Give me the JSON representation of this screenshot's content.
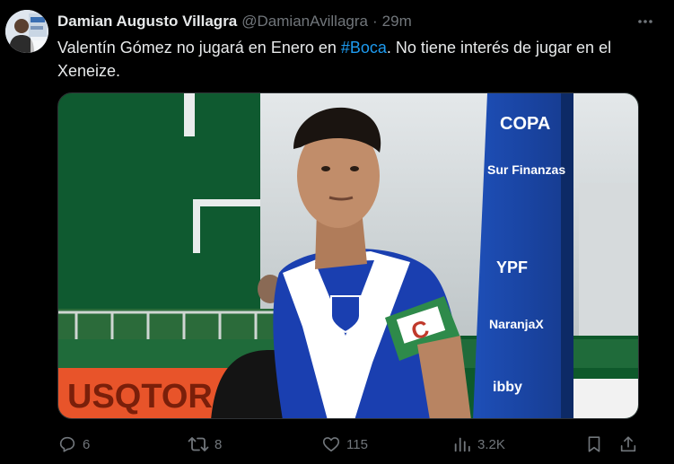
{
  "tweet": {
    "display_name": "Damian Augusto Villagra",
    "handle": "@DamianAvillagra",
    "separator": "·",
    "time": "29m",
    "text_before": "Valentín Gómez no jugará en Enero en ",
    "hashtag": "#Boca",
    "text_after": ". No tiene interés de jugar en el Xeneize.",
    "media": {
      "banner_texts": [
        "COPA",
        "Sur Finanzas",
        "YPF",
        "NaranjaX",
        "ibby"
      ],
      "ad_board_text": "USQTOR",
      "armband_text": "C"
    }
  },
  "actions": {
    "replies": "6",
    "reposts": "8",
    "likes": "115",
    "views": "3.2K"
  },
  "colors": {
    "background": "#000000",
    "text": "#e7e9ea",
    "muted": "#71767b",
    "link": "#1d9bf0"
  },
  "icons": [
    "more-icon",
    "reply-icon",
    "repost-icon",
    "like-icon",
    "views-icon",
    "bookmark-icon",
    "share-icon"
  ]
}
